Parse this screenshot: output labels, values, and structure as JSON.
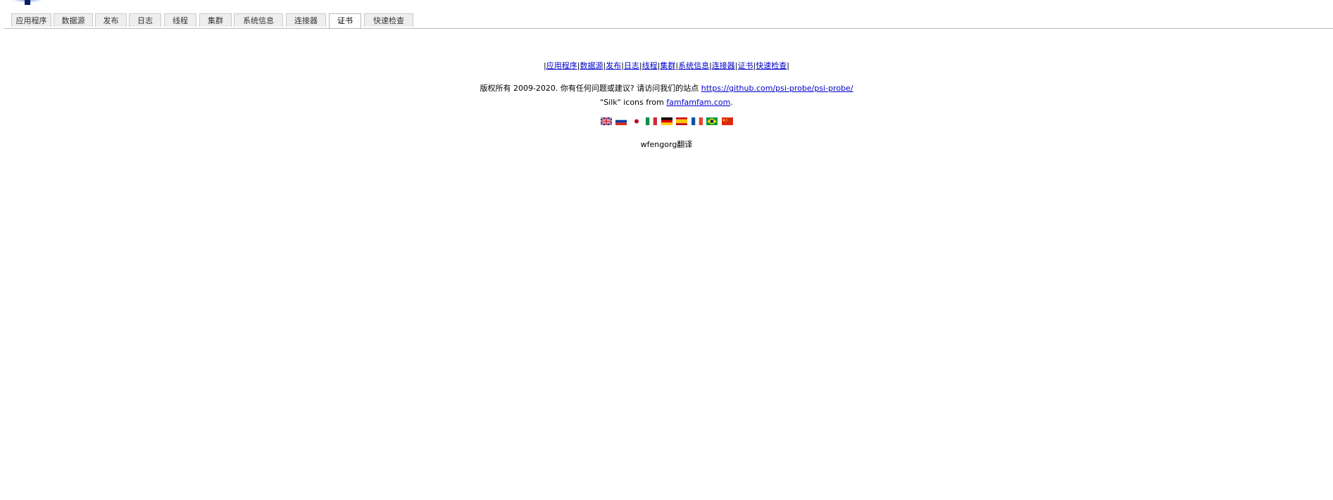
{
  "tabs": [
    {
      "label": "应用程序",
      "active": false
    },
    {
      "label": "数据源",
      "active": false
    },
    {
      "label": "发布",
      "active": false
    },
    {
      "label": "日志",
      "active": false
    },
    {
      "label": "线程",
      "active": false
    },
    {
      "label": "集群",
      "active": false
    },
    {
      "label": "系统信息",
      "active": false
    },
    {
      "label": "连接器",
      "active": false
    },
    {
      "label": "证书",
      "active": true
    },
    {
      "label": "快速检查",
      "active": false
    }
  ],
  "footer": {
    "separator": "|",
    "links": [
      "应用程序",
      "数据源",
      "发布",
      "日志",
      "线程",
      "集群",
      "系统信息",
      "连接器",
      "证书",
      "快速检查"
    ],
    "copyright_text": "版权所有 2009-2020. 你有任何问题或建议? 请访问我们的站点 ",
    "copyright_link": "https://github.com/psi-probe/psi-probe/",
    "credits_prefix": "\"Silk\" icons from ",
    "credits_link": "famfamfam.com",
    "credits_suffix": ".",
    "translator": "wfengorg翻译"
  },
  "flags": [
    "uk-flag-icon",
    "russia-flag-icon",
    "japan-flag-icon",
    "italy-flag-icon",
    "germany-flag-icon",
    "spain-flag-icon",
    "france-flag-icon",
    "brazil-flag-icon",
    "china-flag-icon"
  ],
  "colors": {
    "link": "#0000cc",
    "tab_bg": "#eeeeee",
    "tab_border": "#c9c9c9"
  }
}
